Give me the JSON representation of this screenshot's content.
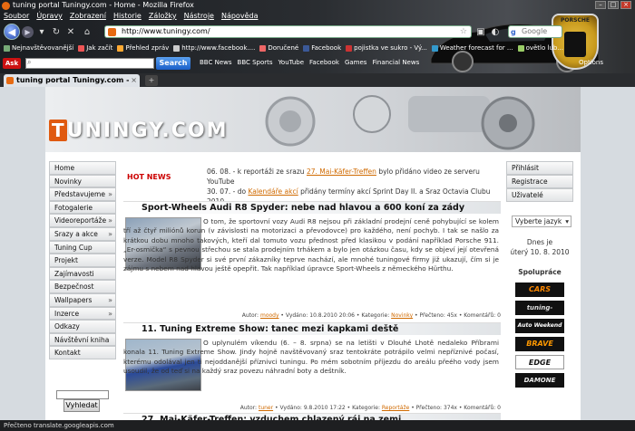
{
  "browser": {
    "window_title": "tuning portal Tuningy.com - Home - Mozilla Firefox",
    "menu": [
      "Soubor",
      "Úpravy",
      "Zobrazení",
      "Historie",
      "Záložky",
      "Nástroje",
      "Nápověda"
    ],
    "url": "http://www.tuningy.com/",
    "search_placeholder": "Google",
    "bookmarks": [
      "Nejnavštěvovanější",
      "Jak začít",
      "Přehled zpráv",
      "http://www.facebook....",
      "Doručené",
      "Facebook",
      "pojistka ve sukro - Vý...",
      "Weather forecast for ...",
      "ovětlo lub..."
    ],
    "ask_button": "Search",
    "ask_logo": "Ask",
    "ask_links": [
      "BBC News",
      "BBC Sports",
      "YouTube",
      "Facebook",
      "Games",
      "Financial News"
    ],
    "options_label": "Options",
    "tab_title": "tuning portal Tuningy.com - Home",
    "status": "Přečteno translate.googleapis.com"
  },
  "site": {
    "logo_t": "T",
    "logo_rest": "UNINGY.COM",
    "left_nav": [
      {
        "label": "Home",
        "arrow": false
      },
      {
        "label": "Novinky",
        "arrow": false
      },
      {
        "label": "Představujeme",
        "arrow": true
      },
      {
        "label": "Fotogalerie",
        "arrow": false
      },
      {
        "label": "Videoreportáže",
        "arrow": true
      },
      {
        "label": "Srazy a akce",
        "arrow": true
      },
      {
        "label": "Tuning Cup",
        "arrow": false
      },
      {
        "label": "Projekt",
        "arrow": false
      },
      {
        "label": "Zajímavosti",
        "arrow": false
      },
      {
        "label": "Bezpečnost",
        "arrow": false
      },
      {
        "label": "Wallpapers",
        "arrow": true
      },
      {
        "label": "Inzerce",
        "arrow": true
      },
      {
        "label": "Odkazy",
        "arrow": false
      },
      {
        "label": "Návštěvní kniha",
        "arrow": false
      },
      {
        "label": "Kontakt",
        "arrow": false
      }
    ],
    "search_button": "Vyhledat",
    "hot_news_label": "HOT NEWS",
    "hot_news": [
      {
        "pre": "06. 08. - k reportáži ze srazu ",
        "link": "27. Mai-Käfer-Treffen",
        "post": " bylo přidáno video ze serveru YouTube"
      },
      {
        "pre": "30. 07. - do ",
        "link": "Kalendáře akcí",
        "post": " přidány termíny akcí Sprint Day II. a Sraz Octavia Clubu 2010"
      }
    ],
    "right_buttons": [
      "Přihlásit",
      "Registrace",
      "Uživatelé"
    ],
    "language_select": "Vyberte jazyk",
    "date_line1": "Dnes je",
    "date_line2": "úterý 10. 8. 2010",
    "partners_title": "Spolupráce",
    "sponsors": [
      "CARS",
      "tuning-sport.cz",
      "Auto Weekend",
      "BRAVE",
      "EDGE",
      "DAMONE"
    ]
  },
  "articles": [
    {
      "title": "Sport-Wheels Audi R8 Spyder: nebe nad hlavou a 600 koní za zády",
      "text": "O tom, že sportovní vozy Audi R8 nejsou při základní prodejní ceně pohybující se kolem tří až čtyř miliónů korun (v závislosti na motorizaci a převodovce) pro každého, není pochyb. I tak se našlo za krátkou dobu mnoho takových, kteří dal tomuto vozu přednost před klasikou v podání například Porsche 911. „Er-osmička“ s pevnou střechou se stala prodejním trhákem a bylo jen otázkou času, kdy se objeví její otevřená verze. Model R8 Spyder si své první zákazníky teprve nachází, ale mnohé tuningové firmy již ukazují, čím si je zájmu s nebem nad hlavou ještě opepřit. Tak například úpravce Sport-Wheels z německého Hürthu.",
      "meta_author_label": "Autor: ",
      "meta_author": "moody",
      "meta_rest": " • Vydáno: 10.8.2010 20:06 • Kategorie: ",
      "meta_cat": "Novinky",
      "meta_tail": " • Přečteno: 45x • Komentářů: 0"
    },
    {
      "title": "11. Tuning Extreme Show: tanec mezi kapkami deště",
      "text": "O uplynulém víkendu (6. – 8. srpna) se na letišti v Dlouhé Lhotě nedaleko Příbrami konala 11. Tuning Extreme Show. Jindy hojně navštěvovaný sraz tentokráte potrápilo velmi nepříznivé počasí, kterému odolával jen ti nejoddanější příznivci tuningu. Po mém sobotním příjezdu do areálu přeého vody jsem usoudil, že od teď si na každý sraz povezu náhradní boty a deštník.",
      "meta_author_label": "Autor: ",
      "meta_author": "tuner",
      "meta_rest": " • Vydáno: 9.8.2010 17:22 • Kategorie: ",
      "meta_cat": "Reportáže",
      "meta_tail": " • Přečteno: 374x • Komentářů: 0"
    },
    {
      "title": "27. Mai-Käfer-Treffen: vzduchem chlazený ráj na zemi"
    }
  ]
}
